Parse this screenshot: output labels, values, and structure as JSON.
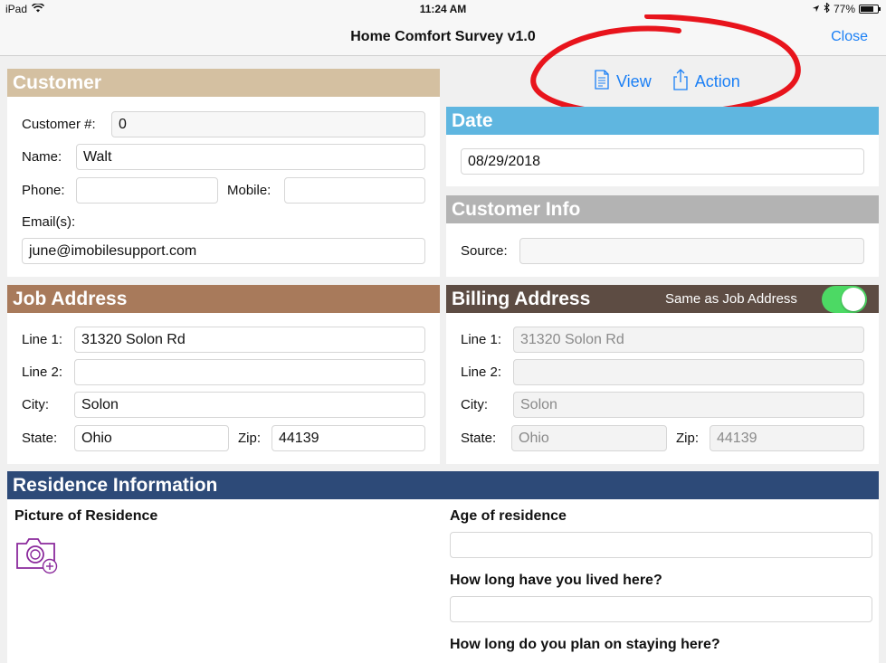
{
  "status_bar": {
    "device": "iPad",
    "time": "11:24 AM",
    "battery": "77%",
    "battery_level": 0.77
  },
  "nav": {
    "title": "Home Comfort Survey v1.0",
    "close": "Close"
  },
  "toolbar": {
    "view": "View",
    "action": "Action"
  },
  "customer": {
    "header": "Customer",
    "number_label": "Customer #:",
    "number_value": "0",
    "name_label": "Name:",
    "name_value": "Walt",
    "phone_label": "Phone:",
    "phone_value": "",
    "mobile_label": "Mobile:",
    "mobile_value": "",
    "email_label": "Email(s):",
    "email_value": "june@imobilesupport.com"
  },
  "date": {
    "header": "Date",
    "value": "08/29/2018"
  },
  "customer_info": {
    "header": "Customer Info",
    "source_label": "Source:",
    "source_value": ""
  },
  "job_address": {
    "header": "Job Address",
    "line1_label": "Line 1:",
    "line1_value": "31320 Solon Rd",
    "line2_label": "Line 2:",
    "line2_value": "",
    "city_label": "City:",
    "city_value": "Solon",
    "state_label": "State:",
    "state_value": "Ohio",
    "zip_label": "Zip:",
    "zip_value": "44139"
  },
  "billing_address": {
    "header": "Billing Address",
    "same_label": "Same as Job Address",
    "same_on": true,
    "line1_label": "Line 1:",
    "line1_value": "31320 Solon Rd",
    "line2_label": "Line 2:",
    "line2_value": "",
    "city_label": "City:",
    "city_value": "Solon",
    "state_label": "State:",
    "state_value": "Ohio",
    "zip_label": "Zip:",
    "zip_value": "44139"
  },
  "residence": {
    "header": "Residence Information",
    "picture_label": "Picture of Residence",
    "age_label": "Age of residence",
    "age_value": "",
    "lived_label": "How long have you lived here?",
    "lived_value": "",
    "plan_label": "How long do you plan on staying here?"
  },
  "colors": {
    "customer": "#d4c0a1",
    "date": "#5fb6e0",
    "customer_info": "#b3b3b3",
    "job_address": "#a87a5b",
    "billing_address": "#5d4c43",
    "residence": "#2d4a78",
    "accent": "#1a7ff5",
    "toggle_on": "#4cd964",
    "annotation": "#e8141c"
  }
}
